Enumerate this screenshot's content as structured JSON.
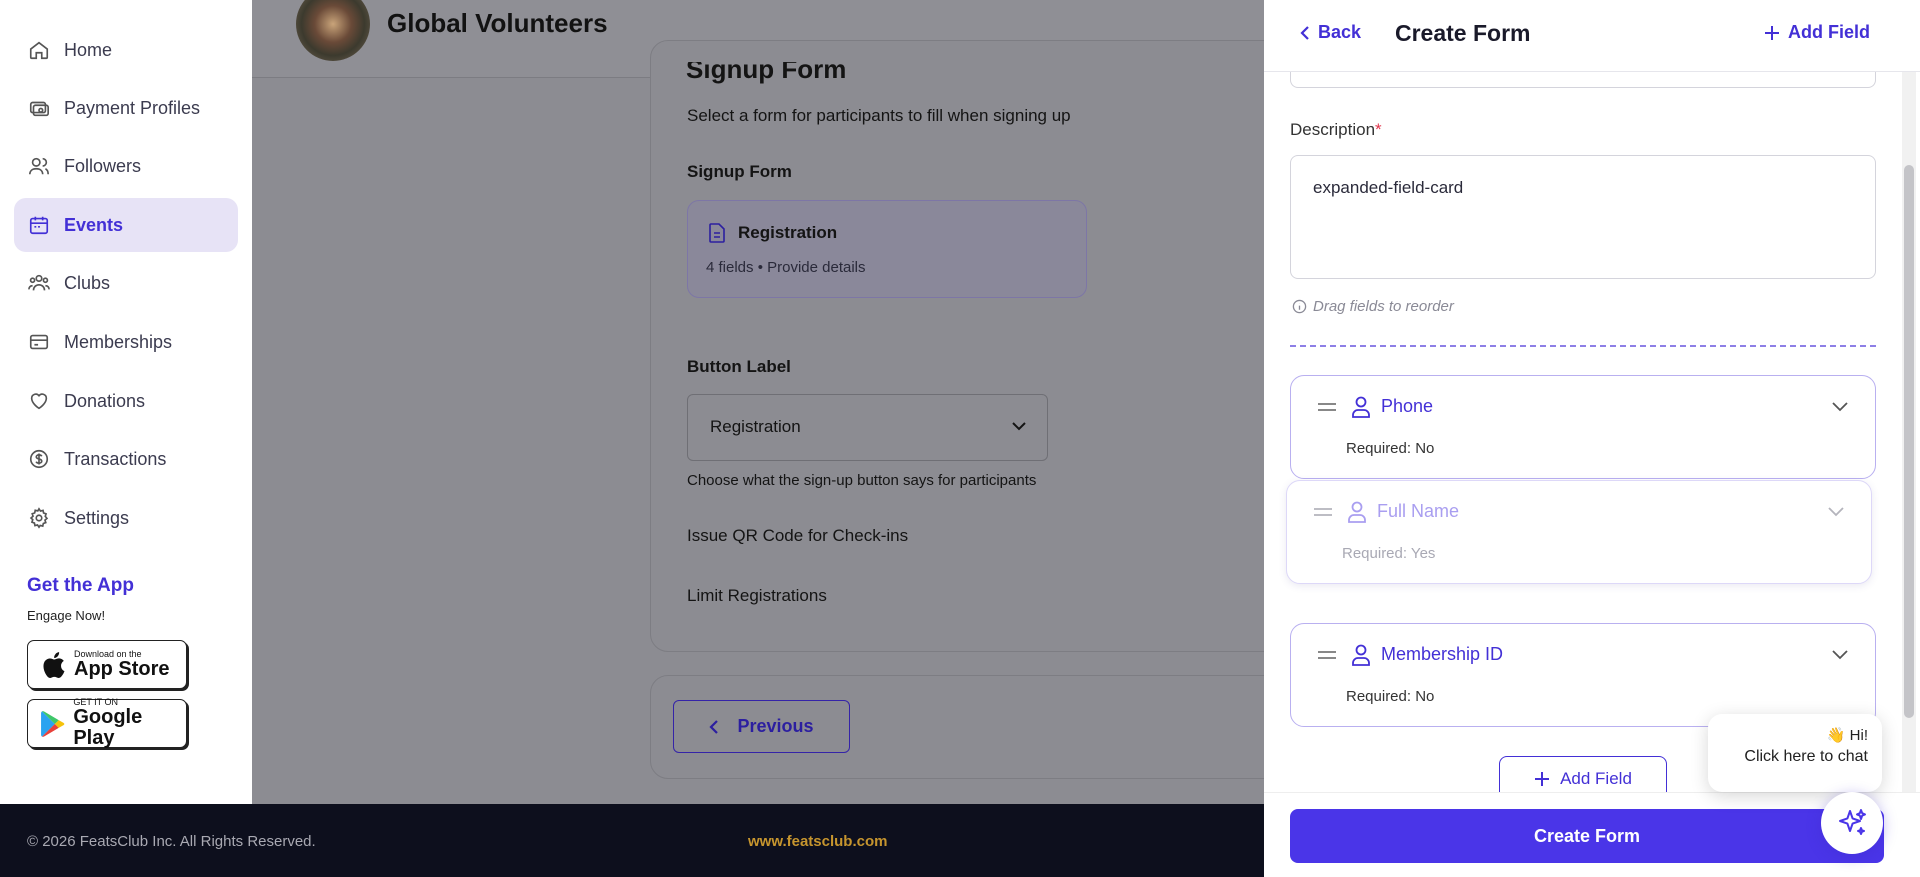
{
  "sidebar": {
    "items": [
      {
        "label": "Home",
        "icon": "home-icon"
      },
      {
        "label": "Payment Profiles",
        "icon": "payment-icon"
      },
      {
        "label": "Followers",
        "icon": "followers-icon"
      },
      {
        "label": "Events",
        "icon": "calendar-icon"
      },
      {
        "label": "Clubs",
        "icon": "clubs-icon"
      },
      {
        "label": "Memberships",
        "icon": "card-icon"
      },
      {
        "label": "Donations",
        "icon": "heart-icon"
      },
      {
        "label": "Transactions",
        "icon": "dollar-icon"
      },
      {
        "label": "Settings",
        "icon": "gear-icon"
      }
    ],
    "active": "Events",
    "get_app": "Get the App",
    "engage": "Engage Now!",
    "app_store": {
      "small": "Download on the",
      "big": "App Store"
    },
    "google_play": {
      "small": "GET IT ON",
      "big": "Google Play"
    }
  },
  "header": {
    "org_name": "Global Volunteers"
  },
  "main": {
    "section_title": "Signup Form",
    "section_desc": "Select a form for participants to fill when signing up",
    "signup_form_label": "Signup Form",
    "selected_form": {
      "name": "Registration",
      "meta": "4 fields • Provide details"
    },
    "button_label_title": "Button Label",
    "button_label_value": "Registration",
    "button_label_help": "Choose what the sign-up button says for participants",
    "qr_label": "Issue QR Code for Check-ins",
    "limit_label": "Limit Registrations",
    "previous_button": "Previous"
  },
  "footer": {
    "copyright": "© 2026 FeatsClub Inc. All Rights Reserved.",
    "website": "www.featsclub.com"
  },
  "panel": {
    "back": "Back",
    "title": "Create Form",
    "add_field_top": "Add Field",
    "description_label": "Description",
    "required_marker": "*",
    "description_value": "expanded-field-card",
    "hint": "Drag fields to reorder",
    "fields": [
      {
        "name": "Phone",
        "required": "Required: No"
      },
      {
        "name": "Full Name",
        "required": "Required: Yes"
      },
      {
        "name": "Membership ID",
        "required": "Required: No"
      }
    ],
    "add_field_button": "Add Field",
    "create_button": "Create Form"
  },
  "chat": {
    "greeting": "👋 Hi!",
    "message": "Click here to chat"
  },
  "colors": {
    "accent": "#4330d6",
    "primary_button": "#4a35e8",
    "footer_bg": "#0d0f1d",
    "link_gold": "#c6952e"
  }
}
